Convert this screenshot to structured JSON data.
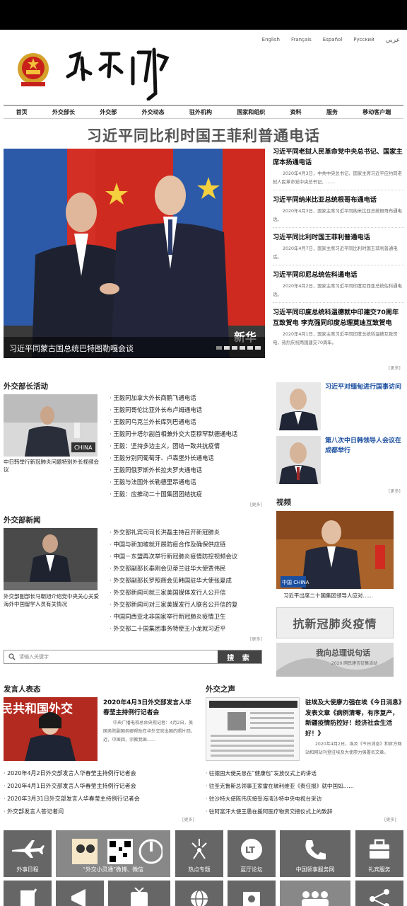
{
  "languages": [
    "English",
    "Français",
    "Español",
    "Русский",
    "عربي"
  ],
  "nav": [
    "首页",
    "外交部长",
    "外交部",
    "外交动态",
    "驻外机构",
    "国家和组织",
    "资料",
    "服务",
    "移动客户端"
  ],
  "headline": "习近平同比利时国王菲利普通电话",
  "hero": {
    "caption": "习近平同蒙古国总统巴特图勒嘎会谈",
    "watermark": "新华"
  },
  "top_news": [
    {
      "title": "习近平同老挝人民革命党中央总书记、国家主席本扬通电话",
      "summary": "2020年4月3日，中共中央总书记、国家主席习近平应约同老挝人民革命党中央总书记、……"
    },
    {
      "title": "习近平同纳米比亚总统根哥布通电话",
      "summary": "2020年4月3日，国家主席习近平同纳米比亚总统根哥布通电话。"
    },
    {
      "title": "习近平同比利时国王菲利普通电话",
      "summary": "2020年4月7日，国家主席习近平同比利时国王菲利普通电话。"
    },
    {
      "title": "习近平同印尼总统佐科通电话",
      "summary": "2020年4月2日，国家主席习近平同印度尼西亚总统佐科通电话。"
    },
    {
      "title": "习近平同印度总统科温德就中印建交70周年互致贺电 李克强同印度总理莫迪互致贺电",
      "summary": "2020年4月1日，国家主席习近平同印度总统科温德互致贺电，热烈庆祝两国建交70周年。"
    }
  ],
  "more": "[更多]",
  "minister": {
    "title": "外交部长活动",
    "caption": "中日韩举行新冠肺炎问题特别外长视频会议",
    "items": [
      "王毅同加拿大外长商鹏飞通电话",
      "王毅同哥伦比亚外长布卢姆通电话",
      "王毅同乌克兰外长库列巴通电话",
      "王毅同卡塔尔副首相兼外交大臣穆罕默德通电话",
      "王毅：坚持多边主义，团结一致共抗疫情",
      "王毅分别同葡萄牙、卢森堡外长通电话",
      "王毅同俄罗斯外长拉夫罗夫通电话",
      "王毅与法国外长勒德里昂通电话",
      "王毅：应推动二十国集团团结抗疫"
    ]
  },
  "ministry": {
    "title": "外交部新闻",
    "caption": "外交部副部长马朝旭介绍党中央关心关爱海外中国留学人员有关情况",
    "items": [
      "外交部礼宾司司长洪磊主持召开新冠肺炎",
      "中国与新加坡就开展防疫合作及确保供应链",
      "中国－东盟再次举行新冠肺炎疫情防控视频会议",
      "外交部副部长秦刚会见蒂兰驻华大使贾伟民",
      "外交部副部长罗照辉会见韩国驻华大使张夏成",
      "外交部新闻司就三家美国媒体发行人公开信",
      "外交部新闻司对三家美媒发行人联名公开信的复",
      "中国同西亚北非国家举行新冠肺炎疫情卫生",
      "外交部二十国集团事务特使王小龙就习近平"
    ]
  },
  "right_features": [
    {
      "title": "习近平对缅甸进行国事访问"
    },
    {
      "title": "第八次中日韩领导人会议在成都举行"
    }
  ],
  "video": {
    "title": "视频",
    "caption": "习近平出席二十国集团领导人应对......",
    "badge": "中国 CHINA"
  },
  "banners": {
    "covid": "抗新冠肺炎疫情",
    "premier": "我向总理说句话",
    "premier_sub": "2020 网民建言征集活动"
  },
  "search": {
    "placeholder": "请输入关键字",
    "button": "搜 索"
  },
  "spokesperson": {
    "title": "发言人表态",
    "feature_title": "2020年4月3日外交部发言人华春莹主持例行记者会",
    "feature_summary": "中央广播电视总台央视记者：4月2日，美国务院副国务卿帮助在华外交官出国的照片回，近，中国回，宗教我国……",
    "banner_text": "民共和国外交",
    "items": [
      "2020年4月2日外交部发言人华春莹主持例行记者会",
      "2020年4月1日外交部发言人华春莹主持例行记者会",
      "2020年3月31日外交部发言人华春莹主持例行记者会",
      "外交部发言人答记者问"
    ]
  },
  "voice": {
    "title": "外交之声",
    "feature_title": "驻埃及大使廖力强在埃《今日消息》发表文章《病例清零，有序复产，新疆疫情防控好！经济社会生活好！》",
    "feature_summary": "2020年4月2日，埃及《今日消息》和官方网站和网站刊登驻埃及大使廖力强署名文章。",
    "items": [
      "驻德国大使吴恳在“健康包”发放仪式上的讲话",
      "驻圣克鲁斯总领事王家雷在玻利维亚《责任报》就中国如……",
      "驻沙特大使陈伟庆接受海湾沙特中央电视台采访",
      "驻阿富汗大使王愚在援阿医疗物资交接仪式上的致辞"
    ]
  },
  "tiles": [
    "外事日程",
    "“外交小灵通”微博、微信",
    "热点专题",
    "蓝厅论坛",
    "中国领事服务网",
    "礼宾服务"
  ]
}
